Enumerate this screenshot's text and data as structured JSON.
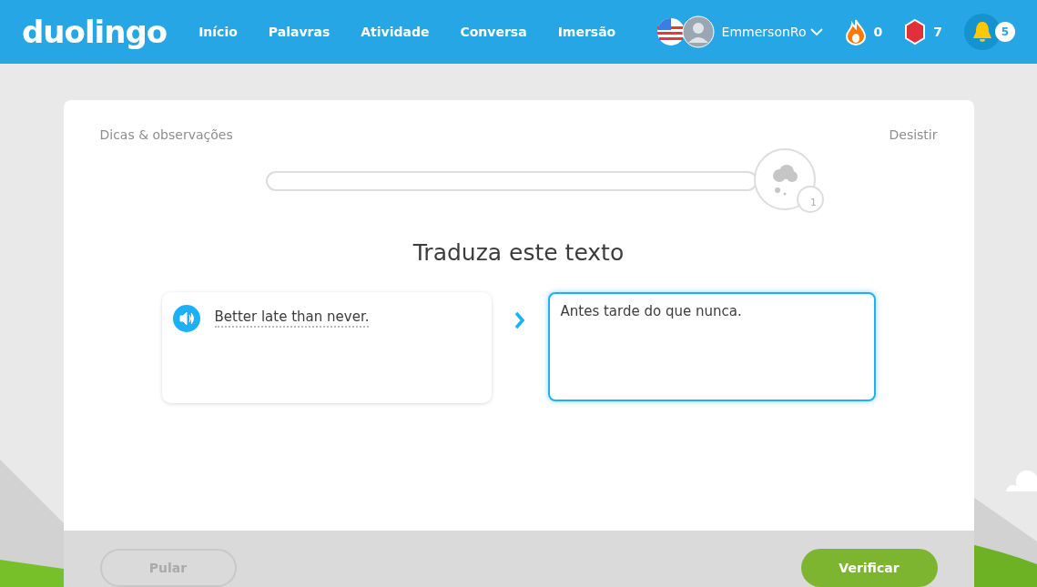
{
  "header": {
    "logo": "duolingo",
    "nav": [
      {
        "label": "Início"
      },
      {
        "label": "Palavras"
      },
      {
        "label": "Atividade"
      },
      {
        "label": "Conversa"
      },
      {
        "label": "Imersão"
      }
    ],
    "username": "EmmersonRo",
    "streak": "0",
    "gems": "7",
    "notifications": "5"
  },
  "lesson": {
    "hints_link": "Dicas & observações",
    "quit_link": "Desistir",
    "progress": {
      "level": 0,
      "bubble_count": "1"
    },
    "title": "Traduza este texto",
    "source_sentence": "Better late than never.",
    "answer": "Antes tarde do que nunca."
  },
  "footer": {
    "skip_button": "Pular",
    "check_button": "Verificar"
  }
}
